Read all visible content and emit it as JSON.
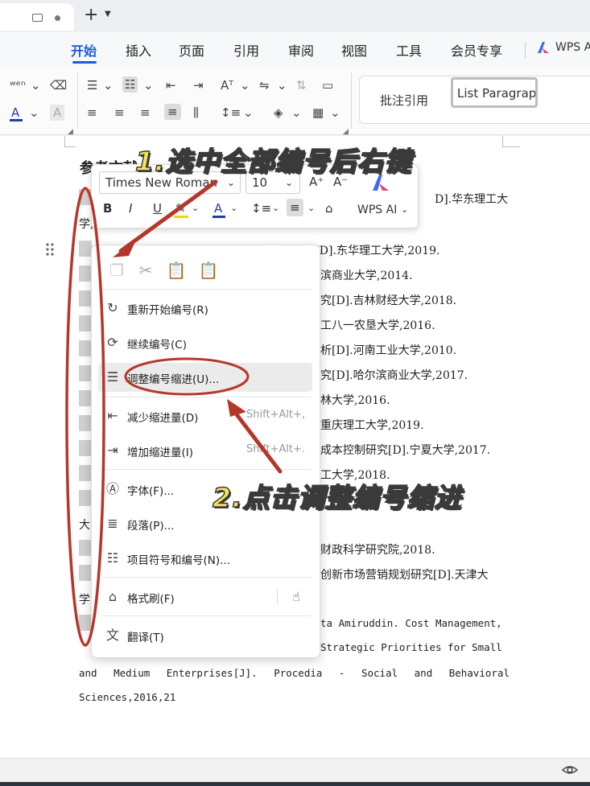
{
  "menu_tabs": [
    "开始",
    "插入",
    "页面",
    "引用",
    "审阅",
    "视图",
    "工具",
    "会员专享"
  ],
  "wps_ai_menu": "WPS AI",
  "style_gallery": {
    "annotate": "批注引用",
    "list_paragraph": "List Paragrap"
  },
  "document": {
    "heading": "参考文献",
    "ref_lines": [
      "D].华东理工大",
      "学,",
      "...管理研究[D].东华理工大学,2019.",
      "滨商业大学,2014.",
      "究[D].吉林财经大学,2018.",
      "工八一农垦大学,2016.",
      "析[D].河南工业大学,2010.",
      "究[D].哈尔滨商业大学,2017.",
      "林大学,2016.",
      "重庆理工大学,2019.",
      "成本控制研究[D].宁夏大学,2017.",
      "工大学,2018.",
      "大",
      "财政科学研究院,2018.",
      "创新市场营销规划研究[D].天津大",
      "学",
      "ta Amiruddin. Cost Management,",
      "Strategic Priorities for Small",
      "and Medium Enterprises[J]. Procedia - Social and Behavioral",
      "Sciences,2016,21"
    ]
  },
  "mini_toolbar": {
    "font_name": "Times New Roman",
    "font_size": "10",
    "bold": "B",
    "italic": "I",
    "underline": "U",
    "wps_ai": "WPS AI"
  },
  "context_menu": {
    "items": [
      {
        "label": "重新开始编号(R)",
        "shortcut": "",
        "icon": "restart-numbering-icon"
      },
      {
        "label": "继续编号(C)",
        "shortcut": "",
        "icon": "continue-numbering-icon"
      },
      {
        "label": "调整编号缩进(U)...",
        "shortcut": "",
        "icon": "adjust-indent-icon"
      },
      {
        "label": "减少缩进量(D)",
        "shortcut": "Shift+Alt+,",
        "icon": "decrease-indent-icon"
      },
      {
        "label": "增加缩进量(I)",
        "shortcut": "Shift+Alt+.",
        "icon": "increase-indent-icon"
      },
      {
        "label": "字体(F)...",
        "shortcut": "",
        "icon": "font-icon"
      },
      {
        "label": "段落(P)...",
        "shortcut": "",
        "icon": "paragraph-icon"
      },
      {
        "label": "项目符号和编号(N)...",
        "shortcut": "",
        "icon": "bullets-numbering-icon"
      },
      {
        "label": "格式刷(F)",
        "shortcut": "",
        "icon": "format-painter-icon"
      },
      {
        "label": "翻译(T)",
        "shortcut": "",
        "icon": "translate-icon"
      }
    ]
  },
  "annotations": {
    "step1": "1.选中全部编号后右键",
    "step2": "2.点击调整编号缩进",
    "color_text": "#f5e35a",
    "color_marker": "#b5372a"
  },
  "colors": {
    "accent": "#1f5bd8",
    "font_color_bar": "#1a3fb0",
    "highlight_bar": "#f1d600"
  }
}
